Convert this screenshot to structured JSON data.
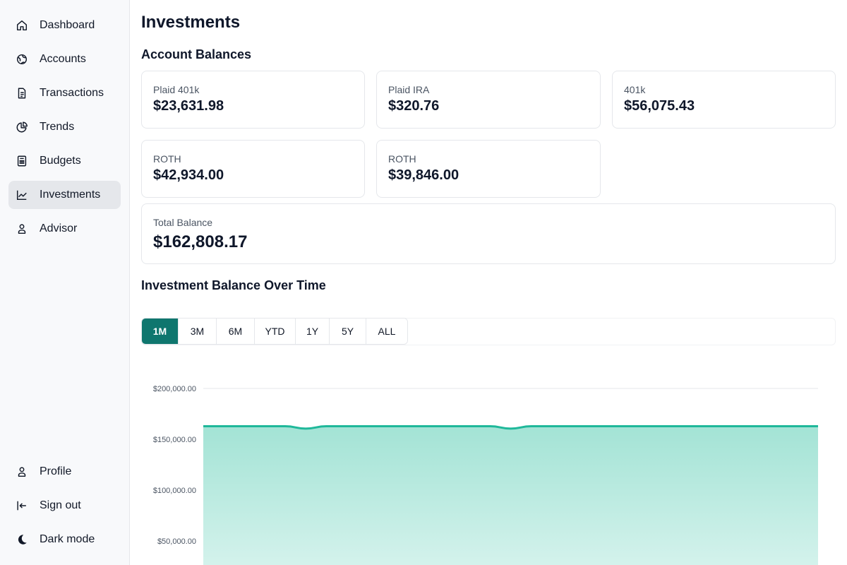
{
  "sidebar": {
    "items": [
      {
        "label": "Dashboard",
        "icon": "home-icon"
      },
      {
        "label": "Accounts",
        "icon": "globe-icon"
      },
      {
        "label": "Transactions",
        "icon": "receipt-icon"
      },
      {
        "label": "Trends",
        "icon": "pie-chart-icon"
      },
      {
        "label": "Budgets",
        "icon": "calculator-icon"
      },
      {
        "label": "Investments",
        "icon": "line-chart-icon",
        "active": true
      },
      {
        "label": "Advisor",
        "icon": "user-icon"
      }
    ],
    "bottom": [
      {
        "label": "Profile",
        "icon": "user-icon"
      },
      {
        "label": "Sign out",
        "icon": "sign-out-icon"
      },
      {
        "label": "Dark mode",
        "icon": "moon-icon"
      }
    ]
  },
  "page": {
    "title": "Investments",
    "balances_title": "Account Balances",
    "chart_title": "Investment Balance Over Time"
  },
  "accounts": [
    {
      "name": "Plaid 401k",
      "balance": "$23,631.98"
    },
    {
      "name": "Plaid IRA",
      "balance": "$320.76"
    },
    {
      "name": "401k",
      "balance": "$56,075.43"
    },
    {
      "name": "ROTH",
      "balance": "$42,934.00"
    },
    {
      "name": "ROTH",
      "balance": "$39,846.00"
    }
  ],
  "total": {
    "label": "Total Balance",
    "value": "$162,808.17"
  },
  "ranges": {
    "options": [
      "1M",
      "3M",
      "6M",
      "YTD",
      "1Y",
      "5Y",
      "ALL"
    ],
    "selected": "1M"
  },
  "colors": {
    "accent": "#0f766e",
    "line": "#1fb89a",
    "fill": "#a7e5d8"
  },
  "chart_data": {
    "type": "area",
    "y_ticks": [
      "$200,000.00",
      "$150,000.00",
      "$100,000.00",
      "$50,000.00"
    ],
    "y_tick_values": [
      200000,
      150000,
      100000,
      50000
    ],
    "x": [
      0,
      1,
      2,
      3,
      4,
      5,
      6,
      7,
      8,
      9,
      10,
      11,
      12,
      13,
      14,
      15,
      16,
      17,
      18,
      19,
      20,
      21,
      22,
      23,
      24,
      25,
      26,
      27,
      28,
      29,
      30
    ],
    "values": [
      162808,
      162808,
      162808,
      162808,
      162808,
      160500,
      162808,
      162808,
      162808,
      162808,
      162808,
      162808,
      162808,
      162808,
      162808,
      160500,
      162808,
      162808,
      162808,
      162808,
      162808,
      162808,
      162808,
      162808,
      162808,
      162808,
      162808,
      162808,
      162808,
      162808,
      162808
    ],
    "ylim": [
      0,
      200000
    ],
    "grid": true
  }
}
